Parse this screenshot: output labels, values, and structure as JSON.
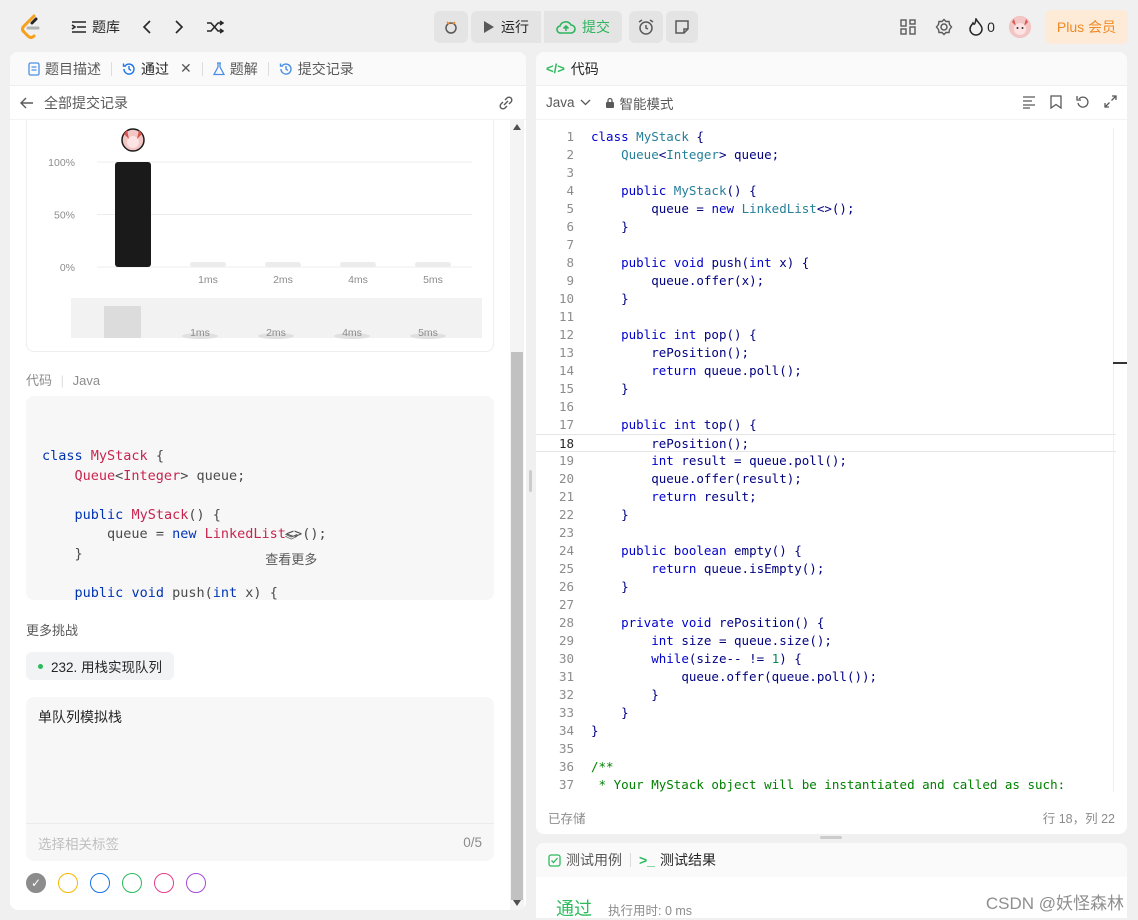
{
  "topbar": {
    "problem_bank": "题库",
    "run": "运行",
    "submit": "提交",
    "streak_count": "0",
    "plus": "Plus 会员"
  },
  "left": {
    "tabs": [
      "题目描述",
      "通过",
      "题解",
      "提交记录"
    ],
    "back_label": "全部提交记录",
    "chart_y_ticks": [
      "100%",
      "50%",
      "0%"
    ],
    "chart_x_ticks": [
      "1ms",
      "2ms",
      "4ms",
      "5ms"
    ],
    "mini_x_ticks": [
      "1ms",
      "2ms",
      "4ms",
      "5ms"
    ],
    "code_label": "代码",
    "code_lang": "Java",
    "code_preview": [
      "class MyStack {",
      "    Queue<Integer> queue;",
      "",
      "    public MyStack() {",
      "        queue = new LinkedList<>();",
      "    }",
      "",
      "    public void push(int x) {"
    ],
    "see_more": "查看更多",
    "more_challenges": "更多挑战",
    "challenge_item": "232. 用栈实现队列",
    "note_text": "单队列模拟栈",
    "tag_placeholder": "选择相关标签",
    "tag_count": "0/5"
  },
  "chart_data": {
    "type": "bar",
    "categories": [
      "",
      "1ms",
      "2ms",
      "4ms",
      "5ms"
    ],
    "values": [
      100,
      0,
      0,
      0,
      0
    ],
    "ylim": [
      0,
      100
    ],
    "y_ticks": [
      "100%",
      "50%",
      "0%"
    ]
  },
  "right": {
    "header": "代码",
    "lang": "Java",
    "mode": "智能模式",
    "code_lines": [
      "class MyStack {",
      "    Queue<Integer> queue;",
      "",
      "    public MyStack() {",
      "        queue = new LinkedList<>();",
      "    }",
      "",
      "    public void push(int x) {",
      "        queue.offer(x);",
      "    }",
      "",
      "    public int pop() {",
      "        rePosition();",
      "        return queue.poll();",
      "    }",
      "",
      "    public int top() {",
      "        rePosition();",
      "        int result = queue.poll();",
      "        queue.offer(result);",
      "        return result;",
      "    }",
      "",
      "    public boolean empty() {",
      "        return queue.isEmpty();",
      "    }",
      "",
      "    private void rePosition() {",
      "        int size = queue.size();",
      "        while(size-- != 1) {",
      "            queue.offer(queue.poll());",
      "        }",
      "    }",
      "}",
      "",
      "/**",
      " * Your MyStack object will be instantiated and called as such:"
    ],
    "current_line": 18,
    "saved": "已存储",
    "cursor_pos": "行 18，列 22"
  },
  "bottom": {
    "tab_testcase": "测试用例",
    "tab_result": "测试结果",
    "result_status": "通过",
    "runtime": "执行用时: 0 ms"
  },
  "watermark": "CSDN @妖怪森林",
  "colors": {
    "accent_green": "#2cbb5d",
    "plus_orange": "#f08a24"
  }
}
